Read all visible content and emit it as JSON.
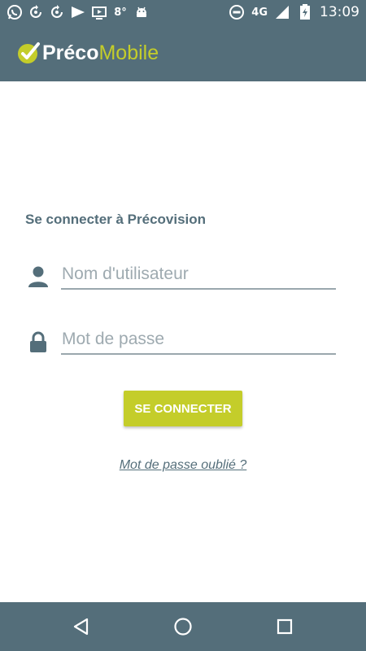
{
  "status_bar": {
    "left_icons": [
      "whatsapp-icon",
      "sync-icon",
      "sync-icon",
      "cast-icon",
      "tv-icon",
      "weather-icon",
      "android-icon"
    ],
    "temperature": "8°",
    "network": "4G",
    "time": "13:09"
  },
  "app_bar": {
    "logo_part1": "Préco",
    "logo_part2": "Mobile"
  },
  "login": {
    "heading": "Se connecter à Précovision",
    "username_placeholder": "Nom d'utilisateur",
    "password_placeholder": "Mot de passe",
    "submit_label": "SE CONNECTER",
    "forgot_link": "Mot de passe oublié ?"
  },
  "colors": {
    "primary": "#546e7a",
    "accent": "#c4cd2a",
    "background": "#ffffff"
  },
  "nav_bar": {
    "buttons": [
      "back-icon",
      "home-icon",
      "recents-icon"
    ]
  }
}
